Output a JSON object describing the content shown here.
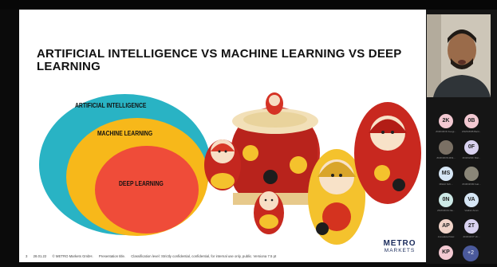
{
  "slide": {
    "title": "ARTIFICIAL INTELLIGENCE VS MACHINE LEARNING VS DEEP LEARNING",
    "diagram": {
      "outer_label": "ARTIFICIAL INTELLIGENCE",
      "middle_label": "MACHINE LEARNING",
      "inner_label": "DEEP LEARNING",
      "colors": {
        "outer": "#29b3c4",
        "middle": "#f7b81a",
        "inner": "#ef4c39"
      }
    },
    "footer": {
      "page": "3",
      "date": "28.01.22",
      "company": "© METRO Markets GmbH.",
      "presentation": "Presentation title.",
      "classification": "Classification level: Strictly confidential, confidential, for internal use only, public. Versiona 7.5 pt"
    },
    "logo": {
      "line1": "METRO",
      "line2": "MARKETS"
    }
  },
  "participants": [
    {
      "initials": "2K",
      "color": "#f3c9d2",
      "name": "ZOZOZOK Kuogi..."
    },
    {
      "initials": "0B",
      "color": "#f3c9d2",
      "name": "ZOZOZOB Barti..."
    },
    {
      "initials": "",
      "color": "#7a7064",
      "name": "ZOZOZOS Mihi..."
    },
    {
      "initials": "0F",
      "color": "#d9d2f0",
      "name": "ZOZOZOF Mat..."
    },
    {
      "initials": "MS",
      "color": "#d6e6f5",
      "name": "MIHAI Sch..."
    },
    {
      "initials": "",
      "color": "#8a8678",
      "name": "ZOZOZOM Gat..."
    },
    {
      "initials": "0N",
      "color": "#cde9e6",
      "name": "ZOZOZON Na..."
    },
    {
      "initials": "VA",
      "color": "#d6e6f5",
      "name": "Vadran Anan"
    },
    {
      "initials": "AP",
      "color": "#f0d3c8",
      "name": "Annadeta Patel"
    },
    {
      "initials": "2T",
      "color": "#d9d2f0",
      "name": "ZOZOZOT Vir..."
    },
    {
      "initials": "KP",
      "color": "#f3c9d2",
      "name": ""
    }
  ],
  "more_participants": "+2"
}
